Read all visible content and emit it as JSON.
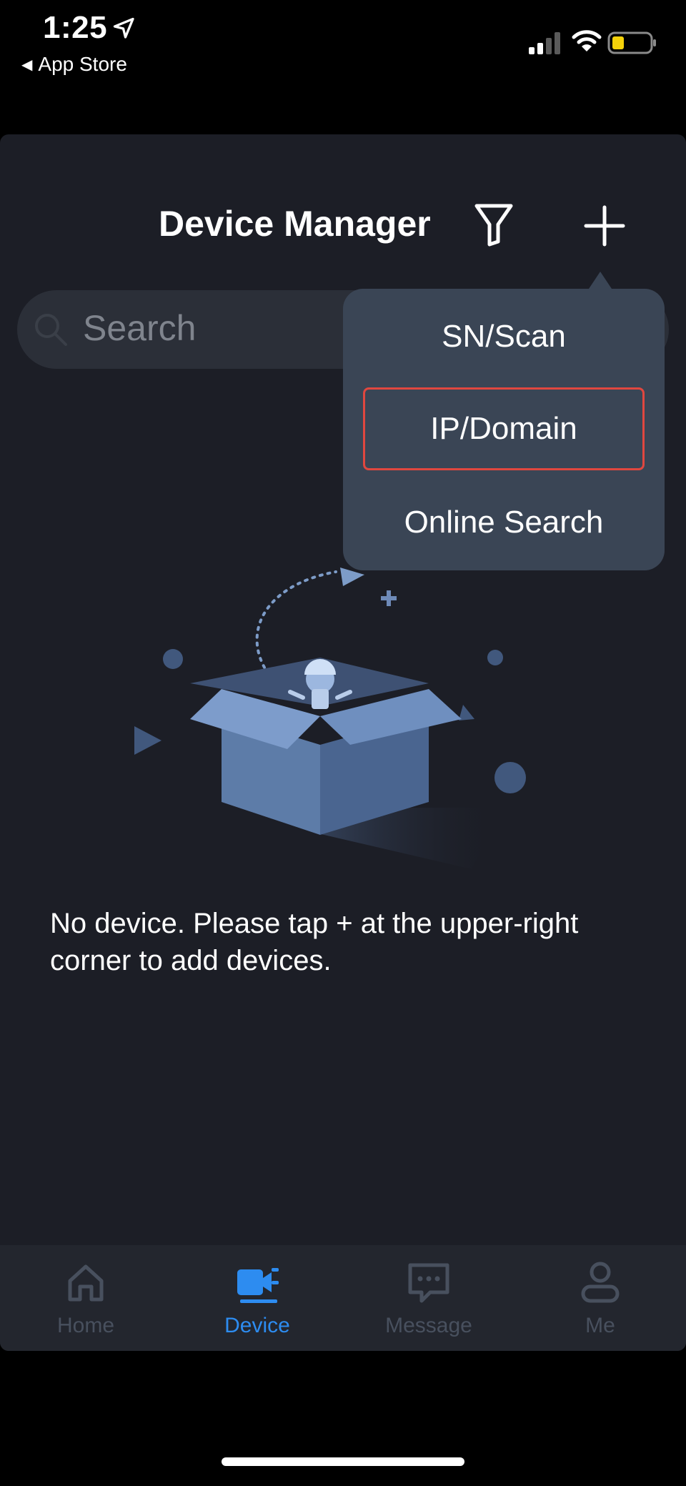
{
  "status_bar": {
    "time": "1:25",
    "back_app": "App Store",
    "icons": [
      "location-arrow-icon",
      "cellular-signal-icon",
      "wifi-icon",
      "battery-icon"
    ]
  },
  "header": {
    "title": "Device Manager",
    "filter_icon": "filter-funnel-icon",
    "add_icon": "plus-icon"
  },
  "search": {
    "placeholder": "Search",
    "icon": "search-icon"
  },
  "dropdown": {
    "items": [
      {
        "label": "SN/Scan"
      },
      {
        "label": "IP/Domain",
        "highlighted": true
      },
      {
        "label": "Online Search"
      }
    ],
    "highlight_color": "#e0473f"
  },
  "empty_state": {
    "illustration": "empty-box-illustration",
    "message": "No device. Please tap + at the upper-right corner to add devices."
  },
  "tabs": [
    {
      "label": "Home",
      "icon": "home-icon",
      "active": false
    },
    {
      "label": "Device",
      "icon": "video-camera-icon",
      "active": true
    },
    {
      "label": "Message",
      "icon": "chat-bubble-icon",
      "active": false
    },
    {
      "label": "Me",
      "icon": "person-icon",
      "active": false
    }
  ],
  "colors": {
    "background": "#000000",
    "panel": "#1c1e26",
    "menu": "#3a4555",
    "accent": "#2d8cf0",
    "inactive_tab": "#48505e"
  }
}
